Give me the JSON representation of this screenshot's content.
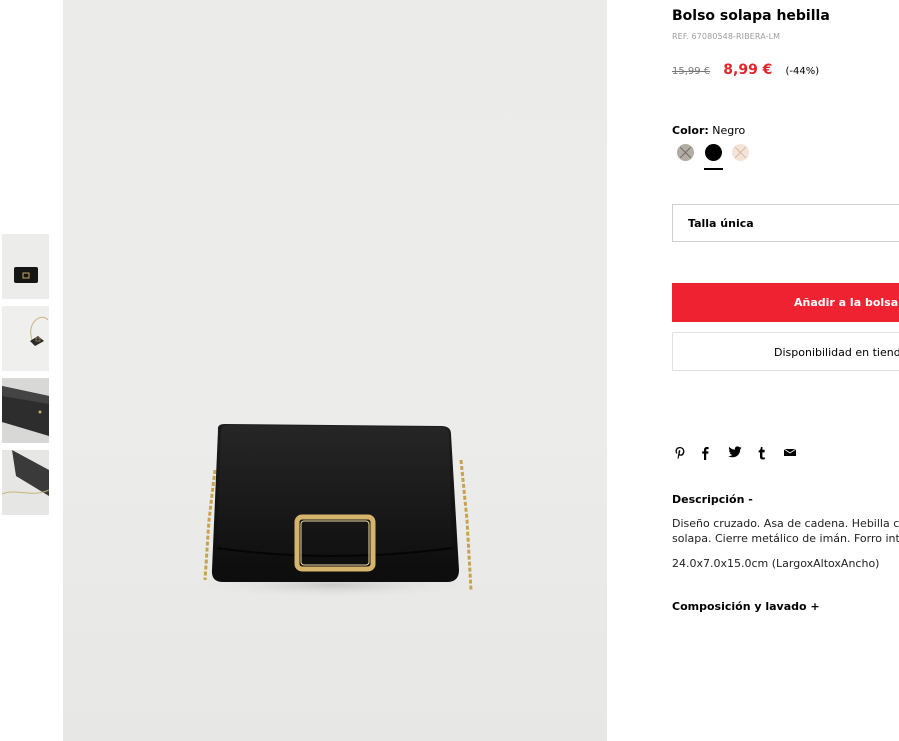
{
  "thumbnails": [
    {
      "icon": "bag-front-thumb"
    },
    {
      "icon": "bag-chain-thumb"
    },
    {
      "icon": "bag-side-thumb"
    },
    {
      "icon": "bag-top-thumb"
    }
  ],
  "product": {
    "title": "Bolso solapa hebilla",
    "ref": "REF. 67080548-RIBERA-LM",
    "old_price": "15,99 €",
    "new_price": "8,99 €",
    "discount": "(-44%)"
  },
  "color": {
    "label": "Color:",
    "value": "Negro",
    "swatches": [
      "#b2aca3",
      "#000000",
      "#f4e3d6"
    ]
  },
  "size": {
    "label": "Talla única"
  },
  "actions": {
    "add_to_bag": "Añadir a la bolsa",
    "store_availability": "Disponibilidad en tiend"
  },
  "share_icons": [
    "pinterest-icon",
    "facebook-icon",
    "twitter-icon",
    "tumblr-icon",
    "email-icon"
  ],
  "description": {
    "heading": "Descripción -",
    "line1": "Diseño cruzado. Asa de cadena. Hebilla c",
    "line2": "solapa. Cierre metálico de imán. Forro int",
    "dimensions": "24.0x7.0x15.0cm (LargoxAltoxAncho)"
  },
  "composition": {
    "heading": "Composición y lavado +"
  },
  "colors": {
    "accent": "#ee2230",
    "price_red": "#e5232b"
  }
}
